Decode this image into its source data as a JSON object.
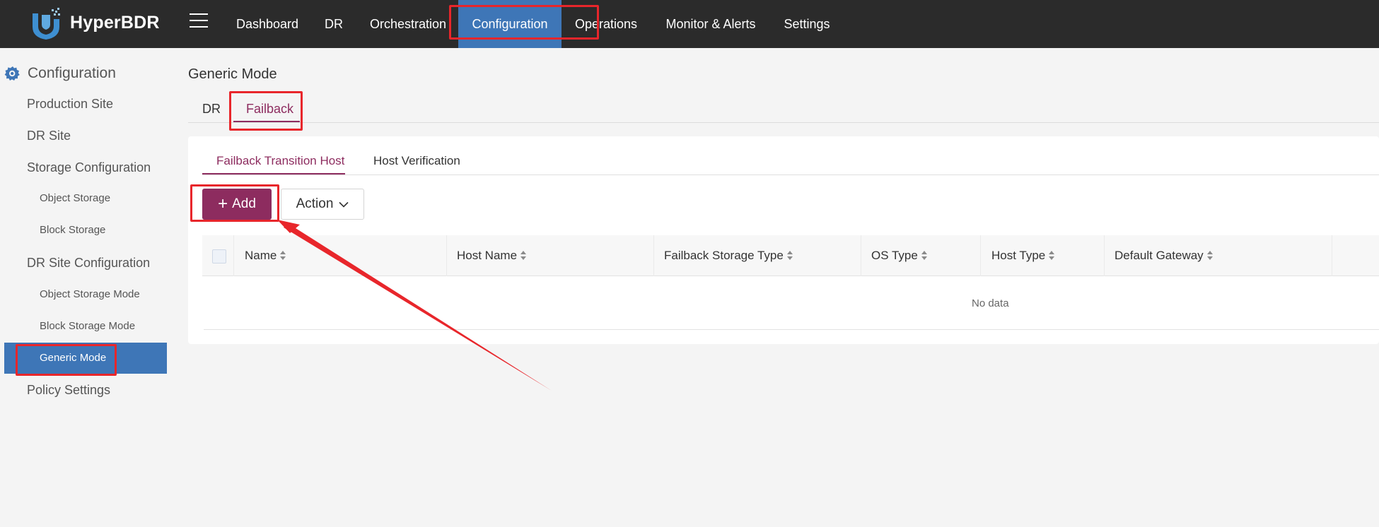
{
  "app": {
    "brand": "HyperBDR",
    "colors": {
      "topbar": "#2b2b2b",
      "active_blue": "#3e76b7",
      "accent": "#8d2c5f",
      "annotation_red": "#e8262b"
    }
  },
  "topnav": {
    "items": [
      {
        "label": "Dashboard",
        "active": false
      },
      {
        "label": "DR",
        "active": false
      },
      {
        "label": "Orchestration",
        "active": false
      },
      {
        "label": "Configuration",
        "active": true
      },
      {
        "label": "Operations",
        "active": false
      },
      {
        "label": "Monitor & Alerts",
        "active": false
      },
      {
        "label": "Settings",
        "active": false
      }
    ]
  },
  "sidebar": {
    "header": "Configuration",
    "header_icon": "gear-icon",
    "items": [
      {
        "label": "Production Site"
      },
      {
        "label": "DR Site"
      },
      {
        "label": "Storage Configuration"
      },
      {
        "label": "Object Storage"
      },
      {
        "label": "Block Storage"
      },
      {
        "label": "DR Site Configuration"
      },
      {
        "label": "Object Storage Mode"
      },
      {
        "label": "Block Storage Mode"
      },
      {
        "label": "Generic Mode",
        "active": true
      },
      {
        "label": "Policy Settings"
      }
    ]
  },
  "main": {
    "title": "Generic Mode",
    "tabs": [
      {
        "label": "DR",
        "active": false
      },
      {
        "label": "Failback",
        "active": true
      }
    ],
    "subtabs": [
      {
        "label": "Failback Transition Host",
        "active": true
      },
      {
        "label": "Host Verification",
        "active": false
      }
    ],
    "toolbar": {
      "add_label": "Add",
      "add_icon": "plus-icon",
      "action_label": "Action",
      "action_icon": "chevron-down-icon"
    },
    "table": {
      "columns": [
        "Name",
        "Host Name",
        "Failback Storage Type",
        "OS Type",
        "Host Type",
        "Default Gateway"
      ],
      "empty_text": "No data"
    }
  }
}
